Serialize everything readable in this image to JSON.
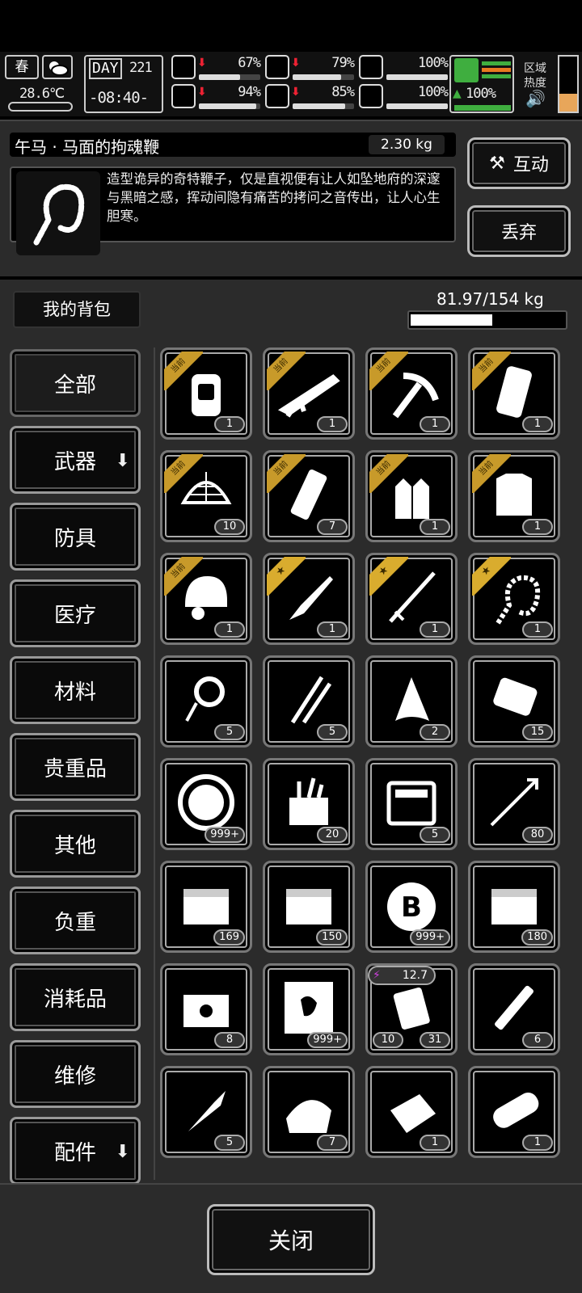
{
  "hud": {
    "season": "春",
    "temperature": "28.6℃",
    "day_label": "DAY",
    "day_value": "221",
    "time": "-08:40-",
    "stats": [
      {
        "name": "health",
        "value": "67%",
        "fill": 0.67,
        "down": true
      },
      {
        "name": "hunger",
        "value": "79%",
        "fill": 0.79,
        "down": true
      },
      {
        "name": "stamina",
        "value": "100%",
        "fill": 1.0,
        "down": false
      },
      {
        "name": "mood",
        "value": "94%",
        "fill": 0.94,
        "down": true
      },
      {
        "name": "thirst",
        "value": "85%",
        "fill": 0.85,
        "down": true
      },
      {
        "name": "heart",
        "value": "100%",
        "fill": 1.0,
        "down": false
      }
    ],
    "speed_value": "100%",
    "zone_heat_label_1": "区域",
    "zone_heat_label_2": "热度"
  },
  "item_detail": {
    "name": "午马 · 马面的拘魂鞭",
    "weight": "2.30 kg",
    "description": "造型诡异的奇特鞭子，仅是直视便有让人如坠地府的深邃与黑暗之感，挥动间隐有痛苦的拷问之音传出，让人心生胆寒。",
    "interact_label": "互动",
    "discard_label": "丢弃"
  },
  "backpack": {
    "title": "我的背包",
    "capacity": "81.97/154 kg",
    "fill": 0.532
  },
  "categories": [
    {
      "label": "全部",
      "selected": true,
      "arrow": false
    },
    {
      "label": "武器",
      "selected": false,
      "arrow": true
    },
    {
      "label": "防具",
      "selected": false,
      "arrow": false
    },
    {
      "label": "医疗",
      "selected": false,
      "arrow": false
    },
    {
      "label": "材料",
      "selected": false,
      "arrow": false
    },
    {
      "label": "贵重品",
      "selected": false,
      "arrow": false
    },
    {
      "label": "其他",
      "selected": false,
      "arrow": false
    },
    {
      "label": "负重",
      "selected": false,
      "arrow": false
    },
    {
      "label": "消耗品",
      "selected": false,
      "arrow": false
    },
    {
      "label": "维修",
      "selected": false,
      "arrow": false
    },
    {
      "label": "配件",
      "selected": false,
      "arrow": true
    }
  ],
  "equipped_tag": "当前",
  "items": [
    {
      "icon": "backpack-icon",
      "count": "1",
      "badge": "equipped"
    },
    {
      "icon": "rifle-icon",
      "count": "1",
      "badge": "equipped"
    },
    {
      "icon": "crossbow-icon",
      "count": "1",
      "badge": "equipped"
    },
    {
      "icon": "bedroll-icon",
      "count": "1",
      "badge": "equipped"
    },
    {
      "icon": "net-helmet-icon",
      "count": "10",
      "badge": "equipped"
    },
    {
      "icon": "flashlight-icon",
      "count": "7",
      "badge": "equipped"
    },
    {
      "icon": "gloves-icon",
      "count": "1",
      "badge": "equipped"
    },
    {
      "icon": "body-armor-icon",
      "count": "1",
      "badge": "equipped"
    },
    {
      "icon": "tactical-helmet-icon",
      "count": "1",
      "badge": "equipped"
    },
    {
      "icon": "machete-icon",
      "count": "1",
      "badge": "star"
    },
    {
      "icon": "katana-icon",
      "count": "1",
      "badge": "star"
    },
    {
      "icon": "whip-icon",
      "count": "1",
      "badge": "star"
    },
    {
      "icon": "rope-icon",
      "count": "5",
      "badge": ""
    },
    {
      "icon": "lockpick-icon",
      "count": "5",
      "badge": ""
    },
    {
      "icon": "cloth-scrap-icon",
      "count": "2",
      "badge": ""
    },
    {
      "icon": "scroll-icon",
      "count": "15",
      "badge": ""
    },
    {
      "icon": "tool-token-icon",
      "count": "999+",
      "badge": ""
    },
    {
      "icon": "toolbox-icon",
      "count": "20",
      "badge": ""
    },
    {
      "icon": "tool-case-icon",
      "count": "5",
      "badge": ""
    },
    {
      "icon": "arrow-icon",
      "count": "80",
      "badge": ""
    },
    {
      "icon": "crate-i-icon",
      "count": "169",
      "badge": ""
    },
    {
      "icon": "crate-ii-icon",
      "count": "150",
      "badge": ""
    },
    {
      "icon": "bitcoin-icon",
      "count": "999+",
      "badge": ""
    },
    {
      "icon": "crate-iii-icon",
      "count": "180",
      "badge": ""
    },
    {
      "icon": "special-crate-icon",
      "count": "8",
      "badge": ""
    },
    {
      "icon": "poster-icon",
      "count": "999+",
      "badge": ""
    },
    {
      "icon": "battery-pack-icon",
      "count": "10",
      "count2": "31",
      "badge": "",
      "charge": "12.7"
    },
    {
      "icon": "glowstick-icon",
      "count": "6",
      "badge": ""
    },
    {
      "icon": "spearhead-icon",
      "count": "5",
      "badge": ""
    },
    {
      "icon": "towel-icon",
      "count": "7",
      "badge": ""
    },
    {
      "icon": "fabric-icon",
      "count": "1",
      "badge": ""
    },
    {
      "icon": "log-icon",
      "count": "1",
      "badge": ""
    }
  ],
  "close_label": "关闭"
}
